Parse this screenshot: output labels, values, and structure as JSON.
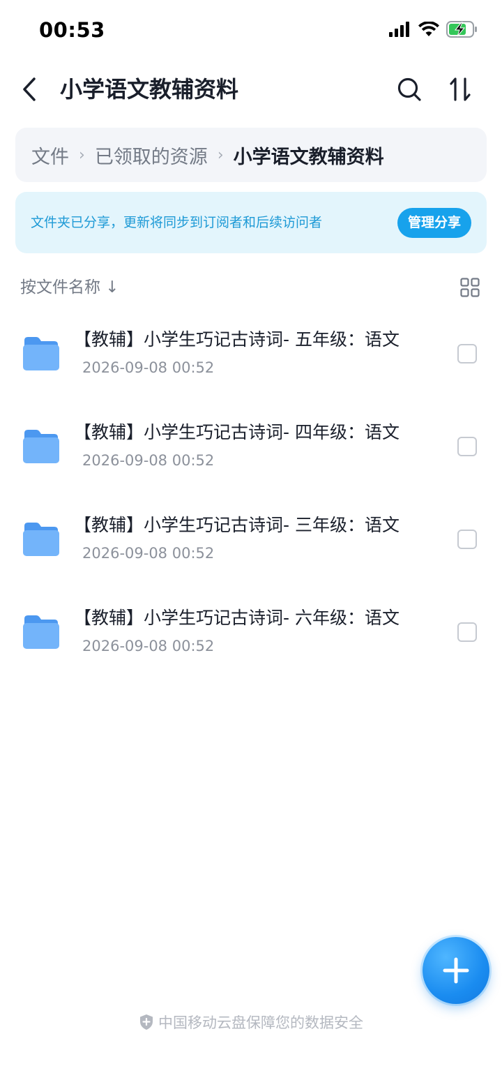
{
  "status_bar": {
    "time": "00:53"
  },
  "header": {
    "title": "小学语文教辅资料"
  },
  "breadcrumb": {
    "items": [
      "文件",
      "已领取的资源",
      "小学语文教辅资料"
    ],
    "separator": "›"
  },
  "share_banner": {
    "text": "文件夹已分享，更新将同步到订阅者和后续访问者",
    "button_label": "管理分享"
  },
  "sort": {
    "label": "按文件名称 ↓"
  },
  "files": [
    {
      "name": "【教辅】小学生巧记古诗词- 五年级：语文",
      "date": "2026-09-08 00:52"
    },
    {
      "name": "【教辅】小学生巧记古诗词- 四年级：语文",
      "date": "2026-09-08 00:52"
    },
    {
      "name": "【教辅】小学生巧记古诗词- 三年级：语文",
      "date": "2026-09-08 00:52"
    },
    {
      "name": "【教辅】小学生巧记古诗词- 六年级：语文",
      "date": "2026-09-08 00:52"
    }
  ],
  "footer": {
    "text": "中国移动云盘保障您的数据安全"
  },
  "colors": {
    "accent": "#17a2ec",
    "folder": "#5aa8f5",
    "banner_bg": "#e3f5fc",
    "breadcrumb_bg": "#f3f5f9"
  },
  "icons": {
    "back": "chevron-left-icon",
    "search": "search-icon",
    "sort": "sort-arrows-icon",
    "grid": "grid-view-icon",
    "folder": "folder-icon",
    "add": "plus-icon",
    "shield": "shield-icon"
  }
}
